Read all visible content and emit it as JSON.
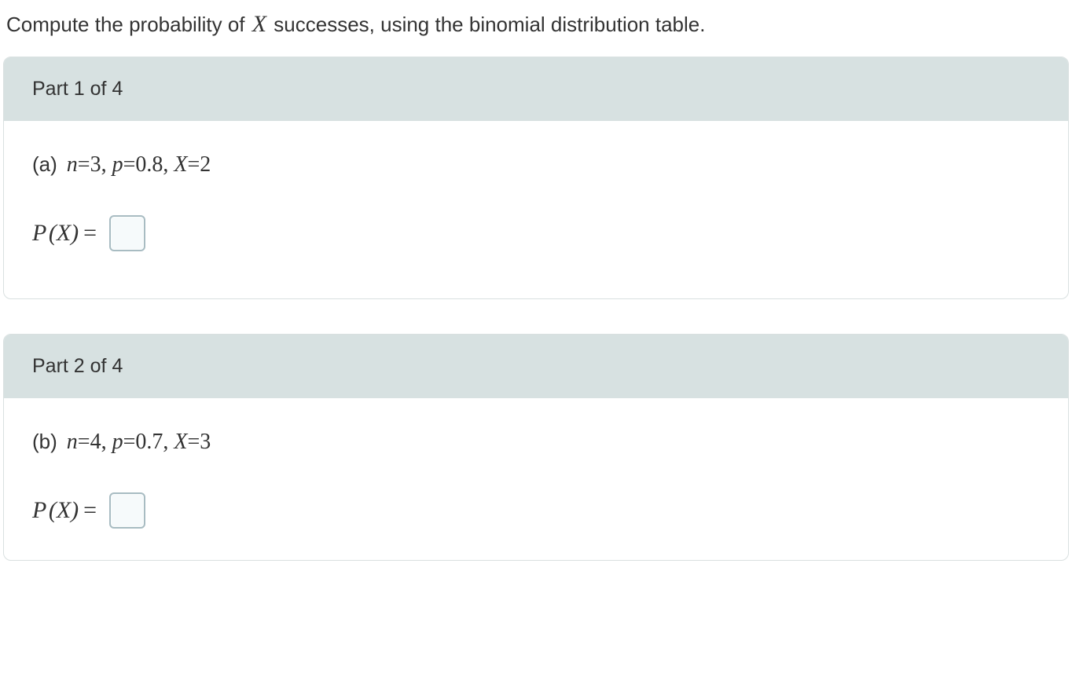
{
  "instruction": {
    "before": "Compute the probability of ",
    "var": "X",
    "after": " successes, using the binomial distribution table."
  },
  "parts": [
    {
      "header": "Part 1 of 4",
      "label": "(a)",
      "params_html": "n=3, p=0.8, X=2",
      "n": "3",
      "p": "0.8",
      "X": "2",
      "answer_prefix": "P(X)=",
      "answer_value": ""
    },
    {
      "header": "Part 2 of 4",
      "label": "(b)",
      "params_html": "n=4, p=0.7, X=3",
      "n": "4",
      "p": "0.7",
      "X": "3",
      "answer_prefix": "P(X)=",
      "answer_value": ""
    }
  ]
}
